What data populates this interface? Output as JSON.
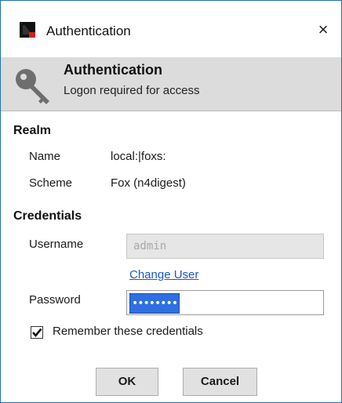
{
  "window": {
    "title": "Authentication",
    "close_label": "×"
  },
  "banner": {
    "title": "Authentication",
    "subtitle": "Logon required for access",
    "icon": "key-icon"
  },
  "realm": {
    "heading": "Realm",
    "name_label": "Name",
    "name_value": "local:|foxs:",
    "scheme_label": "Scheme",
    "scheme_value": "Fox (n4digest)"
  },
  "credentials": {
    "heading": "Credentials",
    "username_label": "Username",
    "username_value": "admin",
    "change_user_label": "Change User",
    "password_label": "Password",
    "password_mask": "••••••••",
    "remember_label": "Remember these credentials",
    "remember_checked": true
  },
  "buttons": {
    "ok_label": "OK",
    "cancel_label": "Cancel"
  }
}
